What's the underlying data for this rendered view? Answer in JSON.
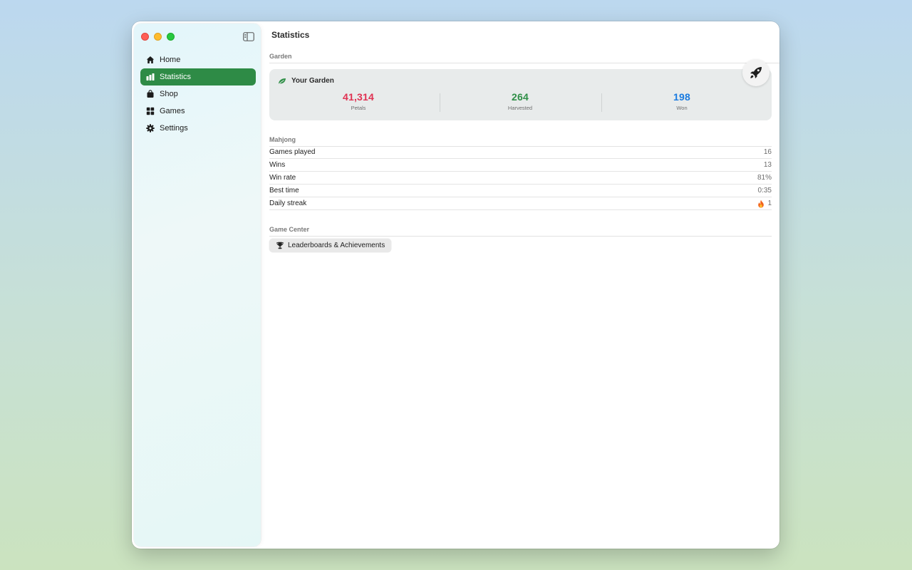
{
  "window": {
    "title": "Statistics"
  },
  "sidebar": {
    "items": [
      {
        "label": "Home",
        "icon": "house-icon",
        "active": false
      },
      {
        "label": "Statistics",
        "icon": "bar-chart-icon",
        "active": true
      },
      {
        "label": "Shop",
        "icon": "bag-icon",
        "active": false
      },
      {
        "label": "Games",
        "icon": "grid-icon",
        "active": false
      },
      {
        "label": "Settings",
        "icon": "gear-icon",
        "active": false
      }
    ]
  },
  "garden": {
    "section_label": "Garden",
    "card_title": "Your Garden",
    "stats": [
      {
        "value": "41,314",
        "label": "Petals",
        "color": "#e03252"
      },
      {
        "value": "264",
        "label": "Harvested",
        "color": "#2f8f47"
      },
      {
        "value": "198",
        "label": "Won",
        "color": "#1a7be0"
      }
    ]
  },
  "mahjong": {
    "section_label": "Mahjong",
    "rows": [
      {
        "label": "Games played",
        "value": "16"
      },
      {
        "label": "Wins",
        "value": "13"
      },
      {
        "label": "Win rate",
        "value": "81%"
      },
      {
        "label": "Best time",
        "value": "0:35"
      },
      {
        "label": "Daily streak",
        "value": "1",
        "icon": "flame-icon"
      }
    ]
  },
  "game_center": {
    "section_label": "Game Center",
    "button_label": "Leaderboards & Achievements"
  },
  "colors": {
    "accent": "#2e8b46",
    "petals": "#e03252",
    "harvested": "#2f8f47",
    "won": "#1a7be0"
  }
}
